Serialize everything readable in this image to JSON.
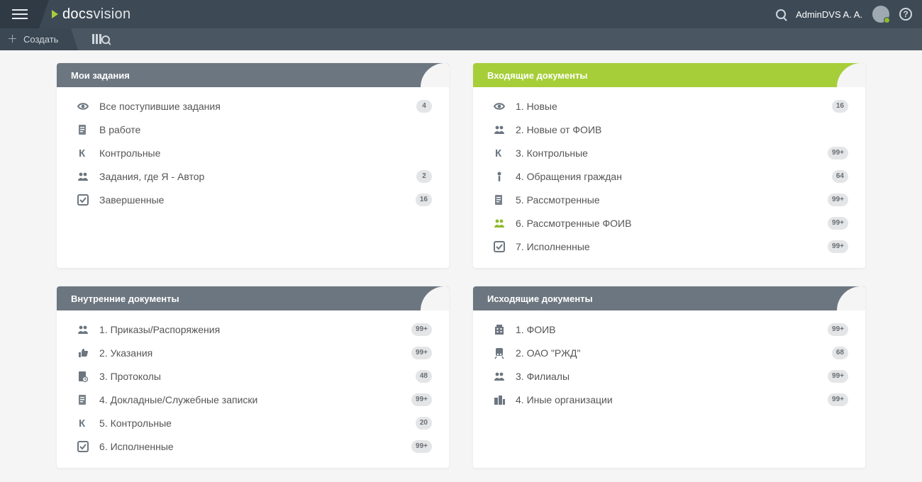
{
  "topbar": {
    "logo_left": "docs",
    "logo_right": "vision",
    "user_name": "AdminDVS A. A."
  },
  "secondbar": {
    "create_label": "Создать"
  },
  "cards": [
    {
      "title": "Мои задания",
      "accent": "gray",
      "rows": [
        {
          "icon": "eye",
          "label": "Все поступившие задания",
          "badge": "4"
        },
        {
          "icon": "doc-edit",
          "label": "В работе",
          "badge": null
        },
        {
          "icon": "k",
          "label": "Контрольные",
          "badge": null
        },
        {
          "icon": "people",
          "label": "Задания, где Я - Автор",
          "badge": "2"
        },
        {
          "icon": "check",
          "label": "Завершенные",
          "badge": "16"
        }
      ]
    },
    {
      "title": "Входящие документы",
      "accent": "lime",
      "rows": [
        {
          "icon": "eye",
          "label": "1. Новые",
          "badge": "16"
        },
        {
          "icon": "people",
          "label": "2. Новые от ФОИВ",
          "badge": null
        },
        {
          "icon": "k",
          "label": "3. Контрольные",
          "badge": "99+"
        },
        {
          "icon": "person",
          "label": "4. Обращения граждан",
          "badge": "64"
        },
        {
          "icon": "doc-edit",
          "label": "5. Рассмотренные",
          "badge": "99+"
        },
        {
          "icon": "people",
          "hl": true,
          "label": "6. Рассмотренные ФОИВ",
          "badge": "99+"
        },
        {
          "icon": "check",
          "label": "7. Исполненные",
          "badge": "99+"
        }
      ]
    },
    {
      "title": "Внутренние документы",
      "accent": "gray",
      "rows": [
        {
          "icon": "people",
          "label": "1. Приказы/Распоряжения",
          "badge": "99+"
        },
        {
          "icon": "thumb",
          "label": "2. Указания",
          "badge": "99+"
        },
        {
          "icon": "doc-clock",
          "label": "3. Протоколы",
          "badge": "48"
        },
        {
          "icon": "doc-edit",
          "label": "4. Докладные/Служебные записки",
          "badge": "99+"
        },
        {
          "icon": "k",
          "label": "5. Контрольные",
          "badge": "20"
        },
        {
          "icon": "check",
          "label": "6. Исполненные",
          "badge": "99+"
        }
      ]
    },
    {
      "title": "Исходящие документы",
      "accent": "gray",
      "rows": [
        {
          "icon": "building",
          "label": "1. ФОИВ",
          "badge": "99+"
        },
        {
          "icon": "train",
          "label": "2. ОАО \"РЖД\"",
          "badge": "68"
        },
        {
          "icon": "people",
          "label": "3. Филиалы",
          "badge": "99+"
        },
        {
          "icon": "city",
          "label": "4. Иные организации",
          "badge": "99+"
        }
      ]
    }
  ]
}
